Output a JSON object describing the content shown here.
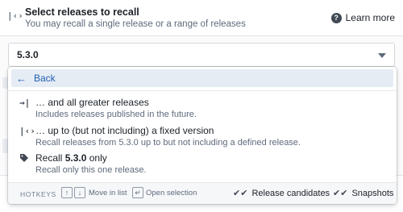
{
  "header": {
    "icon": "code-bracket-icon",
    "title": "Select releases to recall",
    "subtitle": "You may recall a single release or a range of releases",
    "learn_more_label": "Learn more"
  },
  "select": {
    "value": "5.3.0"
  },
  "menu": {
    "back_label": "Back",
    "options": [
      {
        "icon": "arrow-right-to-icon",
        "title": "… and all greater releases",
        "description": "Includes releases published in the future."
      },
      {
        "icon": "code-bracket-icon",
        "title": "… up to (but not including) a fixed version",
        "description": "Recall releases from 5.3.0 up to but not including a defined release."
      },
      {
        "icon": "tag-icon",
        "title_prefix": "Recall ",
        "title_bold": "5.3.0",
        "title_suffix": " only",
        "description": "Recall only this one release."
      }
    ]
  },
  "footer": {
    "hotkeys_label": "HOTKEYS",
    "move_label": "Move in list",
    "open_label": "Open selection",
    "release_candidates_label": "Release candidates",
    "snapshots_label": "Snapshots"
  }
}
